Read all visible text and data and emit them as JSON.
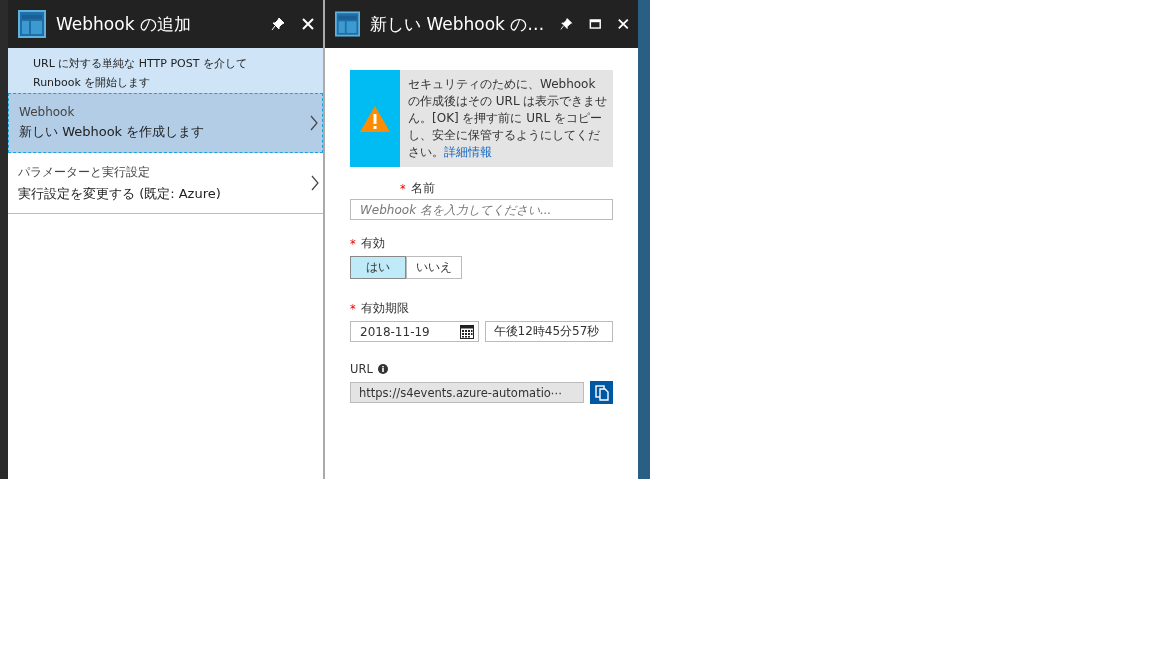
{
  "left_blade": {
    "title": "Webhook の追加",
    "description": "URL に対する単純な HTTP POST を介して\nRunbook を開始します",
    "items": [
      {
        "caption": "Webhook",
        "label": "新しい Webhook を作成します",
        "selected": true
      },
      {
        "caption": "パラメーターと実行設定",
        "label": "実行設定を変更する (既定: Azure)",
        "selected": false
      }
    ]
  },
  "right_blade": {
    "title": "新しい Webhook の…",
    "warning": {
      "text": "セキュリティのために、Webhook の作成後はその URL は表示できません。[OK] を押す前に URL をコピーし、安全に保管するようにしてください。",
      "link": "詳細情報"
    },
    "required_mark": "*",
    "name_field": {
      "label": "名前",
      "required": true,
      "placeholder": "Webhook 名を入力してください..."
    },
    "enabled_field": {
      "label": "有効",
      "required": true,
      "options": [
        {
          "label": "はい",
          "selected": true
        },
        {
          "label": "いいえ",
          "selected": false
        }
      ]
    },
    "expiry_field": {
      "label": "有効期限",
      "required": true,
      "date": "2018-11-19",
      "time": "午後12時45分57秒"
    },
    "url_field": {
      "label": "URL",
      "required": false,
      "value": "https://s4events.azure-automatio⋯"
    }
  }
}
